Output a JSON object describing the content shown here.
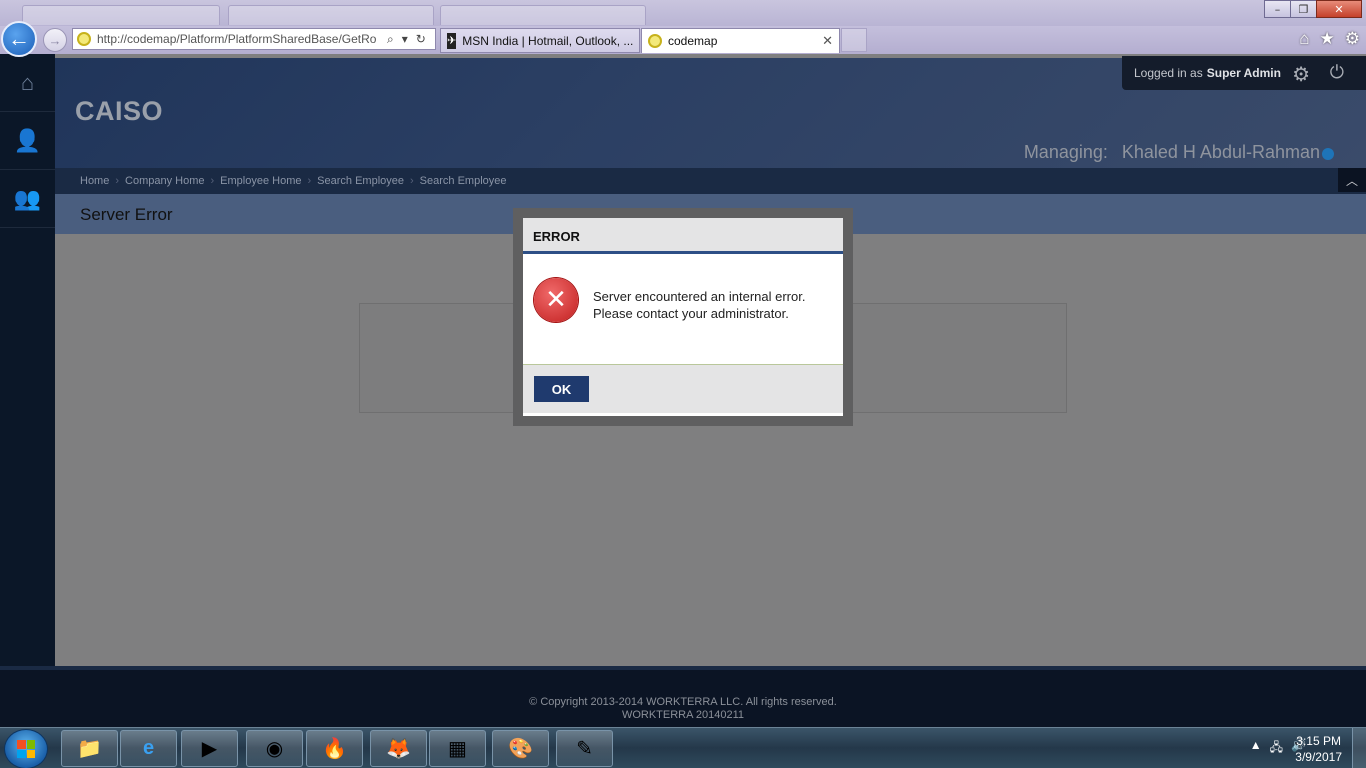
{
  "browser": {
    "address": "http://codemap/Platform/PlatformSharedBase/GetRo",
    "address_host": "codemap",
    "tabs": [
      {
        "title": "MSN India | Hotmail, Outlook, ..."
      },
      {
        "title": "codemap"
      }
    ],
    "icons": [
      "back-arrow-icon",
      "forward-arrow-icon",
      "search-icon",
      "refresh-icon",
      "home-icon",
      "star-icon",
      "gear-icon"
    ]
  },
  "app": {
    "brand": "CAISO",
    "user_prefix": "Logged in as",
    "user_name": "Super Admin",
    "managing_label": "Managing:",
    "managing_name": "Khaled H Abdul-Rahman",
    "breadcrumbs": [
      "Home",
      "Company Home",
      "Employee Home",
      "Search Employee",
      "Search Employee"
    ],
    "page_title": "Server Error",
    "sidebar_icons": [
      "home-icon",
      "person-icon",
      "people-icon"
    ],
    "footer_line1": "© Copyright 2013-2014 WORKTERRA LLC. All rights reserved.",
    "footer_line2": "WORKTERRA 20140211"
  },
  "modal": {
    "title": "ERROR",
    "message": "Server encountered an internal error. Please contact your administrator.",
    "ok_label": "OK",
    "accent": "#2d4f86"
  },
  "taskbar": {
    "time": "3:15 PM",
    "date": "3/9/2017",
    "apps": [
      "file-explorer",
      "internet-explorer",
      "media-player",
      "chrome",
      "burner",
      "firefox",
      "spreadsheet",
      "paint",
      "notepad"
    ]
  }
}
